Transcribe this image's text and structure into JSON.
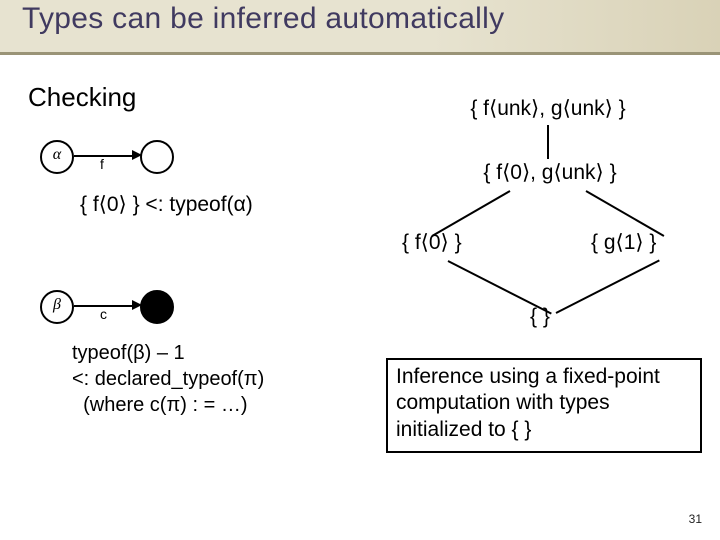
{
  "title": "Types can be inferred automatically",
  "left": {
    "heading": "Checking",
    "alpha": "α",
    "flabel": "f",
    "sub1": "{ f⟨0⟩ } <: typeof(α)",
    "beta": "β",
    "clabel": "c",
    "sub2_l1": "typeof(β) – 1",
    "sub2_l2": "<: declared_typeof(π)",
    "sub2_l3": "  (where c(π) : = …)"
  },
  "lattice": {
    "top": "{ f⟨unk⟩, g⟨unk⟩ }",
    "mid": "{ f⟨0⟩, g⟨unk⟩ }",
    "l": "{ f⟨0⟩ }",
    "r": "{ g⟨1⟩ }",
    "bot": "{ }"
  },
  "inference": "Inference using a fixed-point computation with types initialized to { }",
  "pagenum": "31"
}
